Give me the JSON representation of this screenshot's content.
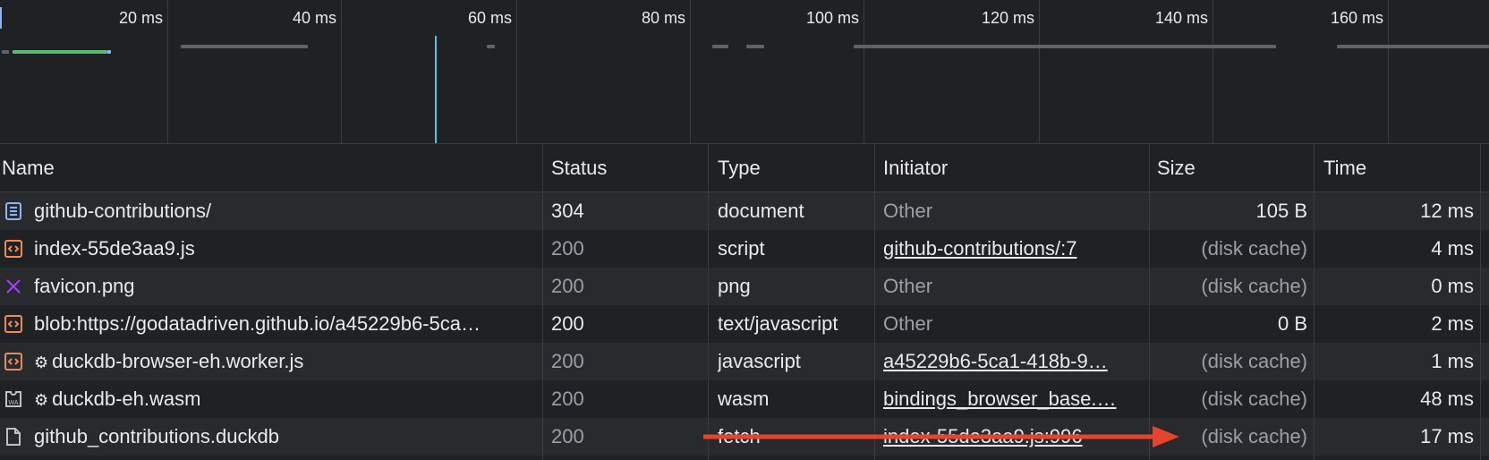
{
  "timeline": {
    "ticks": [
      "20 ms",
      "40 ms",
      "60 ms",
      "80 ms",
      "100 ms",
      "120 ms",
      "140 ms",
      "160 ms"
    ]
  },
  "columns": {
    "name": "Name",
    "status": "Status",
    "type": "Type",
    "initiator": "Initiator",
    "size": "Size",
    "time": "Time"
  },
  "rows": [
    {
      "name": "github-contributions/",
      "status": "304",
      "type": "document",
      "initiator": "Other",
      "size": "105 B",
      "time": "12 ms",
      "icon": "document-icon"
    },
    {
      "name": "index-55de3aa9.js",
      "status": "200",
      "type": "script",
      "initiator": "github-contributions/:7",
      "size": "(disk cache)",
      "time": "4 ms",
      "icon": "script-icon"
    },
    {
      "name": "favicon.png",
      "status": "200",
      "type": "png",
      "initiator": "Other",
      "size": "(disk cache)",
      "time": "0 ms",
      "icon": "image-error-icon"
    },
    {
      "name": "blob:https://godatadriven.github.io/a45229b6-5ca…",
      "status": "200",
      "type": "text/javascript",
      "initiator": "Other",
      "size": "0 B",
      "time": "2 ms",
      "icon": "script-icon"
    },
    {
      "name": "duckdb-browser-eh.worker.js",
      "status": "200",
      "type": "javascript",
      "initiator": "a45229b6-5ca1-418b-9…",
      "size": "(disk cache)",
      "time": "1 ms",
      "icon": "script-icon",
      "gear": "⚙"
    },
    {
      "name": "duckdb-eh.wasm",
      "status": "200",
      "type": "wasm",
      "initiator": "bindings_browser_base.…",
      "size": "(disk cache)",
      "time": "48 ms",
      "icon": "wasm-icon",
      "gear": "⚙"
    },
    {
      "name": "github_contributions.duckdb",
      "status": "200",
      "type": "fetch",
      "initiator": "index-55de3aa9.js:996",
      "size": "(disk cache)",
      "time": "17 ms",
      "icon": "file-icon"
    }
  ],
  "annotation": {
    "color": "#e8432d",
    "icon": "red-arrow-icon"
  },
  "colors": {
    "bg": "#202124",
    "row_alt": "#292a2d",
    "text": "#e8eaed",
    "dim_text": "#9aa0a6",
    "script_icon": "#f28b54",
    "doc_icon": "#8ab4f8",
    "error_icon": "#a142f4",
    "bar_green": "#5bb974",
    "bar_gray": "#5f6368",
    "dcl_line": "#4fc3f7"
  }
}
